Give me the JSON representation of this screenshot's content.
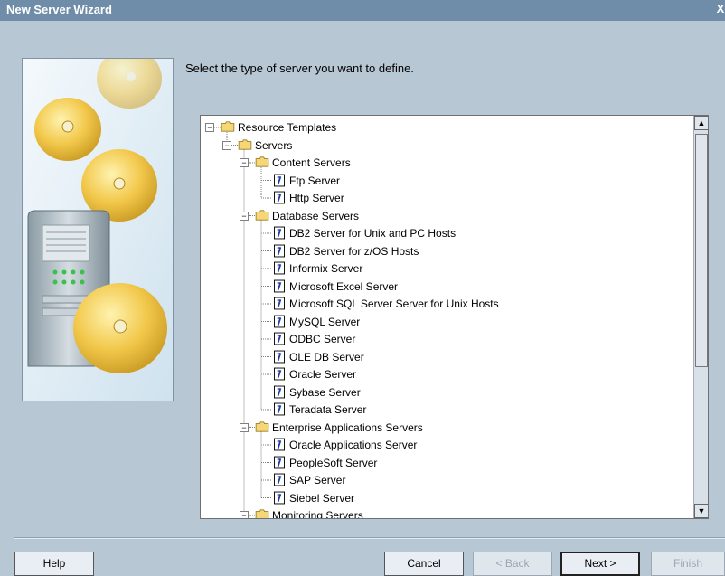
{
  "window": {
    "title": "New Server Wizard",
    "close_label": "X"
  },
  "prompt": "Select the type of server you want to define.",
  "tree": {
    "root": "Resource Templates",
    "servers_label": "Servers",
    "groups": [
      {
        "label": "Content Servers",
        "items": [
          "Ftp Server",
          "Http Server"
        ]
      },
      {
        "label": "Database Servers",
        "items": [
          "DB2 Server for Unix and PC Hosts",
          "DB2 Server for z/OS Hosts",
          "Informix Server",
          "Microsoft Excel Server",
          "Microsoft SQL Server Server for Unix Hosts",
          "MySQL Server",
          "ODBC Server",
          "OLE DB Server",
          "Oracle Server",
          "Sybase Server",
          "Teradata Server"
        ]
      },
      {
        "label": "Enterprise Applications Servers",
        "items": [
          "Oracle Applications Server",
          "PeopleSoft Server",
          "SAP Server",
          "Siebel Server"
        ]
      },
      {
        "label": "Monitoring Servers",
        "items": []
      }
    ]
  },
  "buttons": {
    "help": "Help",
    "cancel": "Cancel",
    "back": "< Back",
    "next": "Next >",
    "finish": "Finish"
  },
  "icons": {
    "folder": "folder-icon",
    "document": "document-icon",
    "expand": "minus-icon"
  },
  "colors": {
    "title_bar": "#6f8ca8",
    "dialog_bg": "#b8c7d4",
    "folder": "#f5d777",
    "disc": "#f0c048"
  }
}
